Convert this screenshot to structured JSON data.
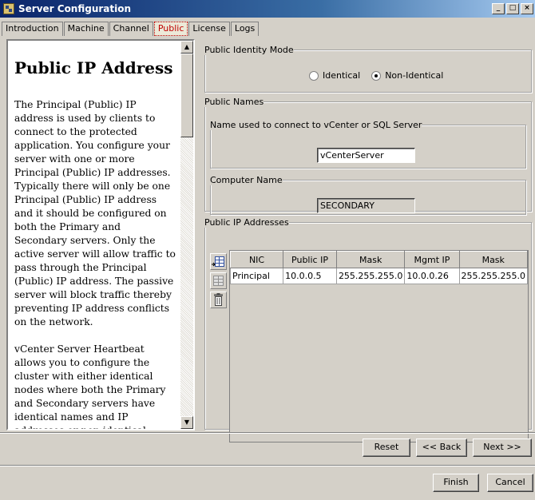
{
  "window": {
    "title": "Server Configuration"
  },
  "window_buttons": {
    "minimize": "_",
    "maximize": "□",
    "close": "×"
  },
  "tabs": [
    {
      "label": "Introduction"
    },
    {
      "label": "Machine"
    },
    {
      "label": "Channel"
    },
    {
      "label": "Public",
      "active": true
    },
    {
      "label": "License"
    },
    {
      "label": "Logs"
    }
  ],
  "help": {
    "heading": "Public IP Address",
    "paragraph1": "The Principal (Public) IP address is used by clients to connect to the protected application. You configure your server with one or more Principal (Public) IP addresses. Typically there will only be one Principal (Public) IP address and it should be configured on both the Primary and Secondary servers. Only the active server will allow traffic to pass through the Principal (Public) IP address. The passive server will block traffic thereby preventing IP address conflicts on the network.",
    "paragraph2": "vCenter Server Heartbeat allows you to configure the cluster with either identical nodes where both the Primary and Secondary servers have identical names and IP addresses or non-identical nodes where the Primary and Secondary servers have different names and IP addresses."
  },
  "identity_mode": {
    "legend": "Public Identity Mode",
    "options": [
      {
        "label": "Identical",
        "checked": false
      },
      {
        "label": "Non-Identical",
        "checked": true
      }
    ]
  },
  "public_names": {
    "legend": "Public Names",
    "connect_group": {
      "legend": "Name used to connect to vCenter or SQL Server",
      "value": "vCenterServer"
    },
    "computer_group": {
      "legend": "Computer Name",
      "value": "SECONDARY"
    }
  },
  "ip_addresses": {
    "legend": "Public IP Addresses",
    "columns": [
      "NIC",
      "Public IP",
      "Mask",
      "Mgmt IP",
      "Mask"
    ],
    "rows": [
      [
        "Principal",
        "10.0.0.5",
        "255.255.255.0",
        "10.0.0.26",
        "255.255.255.0"
      ]
    ],
    "tools": [
      "add-row-icon",
      "edit-row-icon",
      "delete-icon"
    ]
  },
  "nav_buttons": {
    "reset": "Reset",
    "back": "<< Back",
    "next": "Next >>"
  },
  "footer_buttons": {
    "finish": "Finish",
    "cancel": "Cancel"
  },
  "scrollbar_arrows": {
    "up": "▲",
    "down": "▼"
  }
}
